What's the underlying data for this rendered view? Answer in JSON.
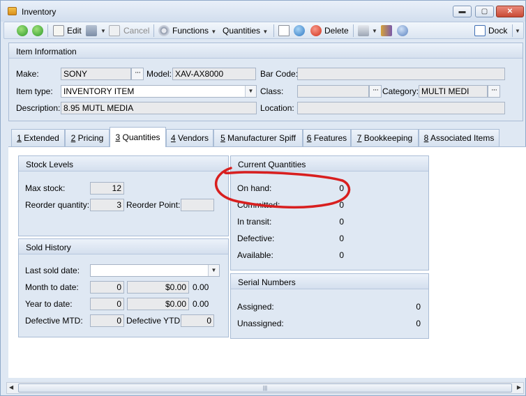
{
  "window": {
    "title": "Inventory"
  },
  "titlebar_buttons": {
    "minimize": "▬",
    "maximize": "▢",
    "close": "✕"
  },
  "toolbar": {
    "edit": "Edit",
    "cancel": "Cancel",
    "functions": "Functions",
    "quantities": "Quantities",
    "delete": "Delete",
    "dock": "Dock"
  },
  "item_info": {
    "header": "Item Information",
    "make_label": "Make:",
    "make_value": "SONY",
    "model_label": "Model:",
    "model_value": "XAV-AX8000",
    "barcode_label": "Bar Code:",
    "barcode_value": "",
    "itemtype_label": "Item type:",
    "itemtype_value": "INVENTORY ITEM",
    "class_label": "Class:",
    "class_value": "",
    "category_label": "Category:",
    "category_value": "MULTI MEDI",
    "description_label": "Description:",
    "description_value": "8.95 MUTL MEDIA",
    "location_label": "Location:",
    "location_value": ""
  },
  "tabs": [
    {
      "num": "1",
      "label": " Extended"
    },
    {
      "num": "2",
      "label": " Pricing"
    },
    {
      "num": "3",
      "label": " Quantities"
    },
    {
      "num": "4",
      "label": " Vendors"
    },
    {
      "num": "5",
      "label": " Manufacturer Spiff"
    },
    {
      "num": "6",
      "label": " Features"
    },
    {
      "num": "7",
      "label": " Bookkeeping"
    },
    {
      "num": "8",
      "label": " Associated Items"
    }
  ],
  "stock_levels": {
    "header": "Stock Levels",
    "max_stock_label": "Max stock:",
    "max_stock_value": "12",
    "reorder_qty_label": "Reorder quantity:",
    "reorder_qty_value": "3",
    "reorder_point_label": "Reorder Point:",
    "reorder_point_value": ""
  },
  "sold_history": {
    "header": "Sold History",
    "last_sold_label": "Last sold date:",
    "last_sold_value": "",
    "mtd_label": "Month to date:",
    "mtd_qty": "0",
    "mtd_amount": "$0.00",
    "mtd_extra": "0.00",
    "ytd_label": "Year to date:",
    "ytd_qty": "0",
    "ytd_amount": "$0.00",
    "ytd_extra": "0.00",
    "def_mtd_label": "Defective MTD:",
    "def_mtd_value": "0",
    "def_ytd_label": "Defective YTD:",
    "def_ytd_value": "0"
  },
  "current_quantities": {
    "header": "Current Quantities",
    "on_hand_label": "On hand:",
    "on_hand_value": "0",
    "committed_label": "Committed:",
    "committed_value": "0",
    "in_transit_label": "In transit:",
    "in_transit_value": "0",
    "defective_label": "Defective:",
    "defective_value": "0",
    "available_label": "Available:",
    "available_value": "0"
  },
  "serial_numbers": {
    "header": "Serial Numbers",
    "assigned_label": "Assigned:",
    "assigned_value": "0",
    "unassigned_label": "Unassigned:",
    "unassigned_value": "0"
  },
  "scrollbar": {
    "grip": "|||"
  },
  "colors": {
    "annotation": "#d81f1f",
    "accent": "#dfe8f3"
  }
}
